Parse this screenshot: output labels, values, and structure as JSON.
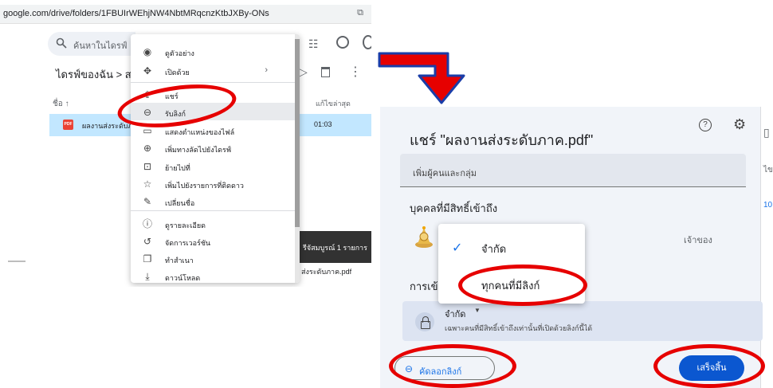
{
  "drive": {
    "url": "google.com/drive/folders/1FBUIrWEhjNW4NbtMRqcnzKtbJXBy-ONs",
    "search_placeholder": "ค้นหาในไดรฟ์",
    "breadcrumb": "ไดรฟ์ของฉัน  >  ส",
    "column_name": "ชื่อ ↑",
    "column_modified": "แก้ไขล่าสุด",
    "file": {
      "name": "ผลงานส่งระดับภ",
      "time": "01:03",
      "icon_label": "PDF"
    },
    "notification": "รีจัสมบูรณ์ 1 รายการ",
    "notification_sub": "ส่งระดับภาค.pdf"
  },
  "context_menu": {
    "items": [
      {
        "icon": "eye-icon",
        "glyph": "◉",
        "label": "ดูตัวอย่าง",
        "chevron": ""
      },
      {
        "icon": "open-with-icon",
        "glyph": "✥",
        "label": "เปิดด้วย",
        "chevron": "›"
      },
      {
        "icon": "share-icon",
        "glyph": "⇪",
        "label": "แชร์",
        "chevron": ""
      },
      {
        "icon": "link-icon",
        "glyph": "⊖",
        "label": "รับลิงก์",
        "chevron": ""
      },
      {
        "icon": "file-location-icon",
        "glyph": "▭",
        "label": "แสดงตำแหน่งของไฟล์",
        "chevron": ""
      },
      {
        "icon": "shortcut-icon",
        "glyph": "⊕",
        "label": "เพิ่มทางลัดไปยังไดรฟ์",
        "chevron": ""
      },
      {
        "icon": "move-icon",
        "glyph": "⊡",
        "label": "ย้ายไปที่",
        "chevron": ""
      },
      {
        "icon": "star-icon",
        "glyph": "☆",
        "label": "เพิ่มไปยังรายการที่ติดดาว",
        "chevron": ""
      },
      {
        "icon": "rename-icon",
        "glyph": "✎",
        "label": "เปลี่ยนชื่อ",
        "chevron": ""
      },
      {
        "icon": "info-icon",
        "glyph": "ⓘ",
        "label": "ดูรายละเอียด",
        "chevron": ""
      },
      {
        "icon": "history-icon",
        "glyph": "↺",
        "label": "จัดการเวอร์ชัน",
        "chevron": ""
      },
      {
        "icon": "copy-icon",
        "glyph": "❐",
        "label": "ทำสำเนา",
        "chevron": ""
      },
      {
        "icon": "download-icon",
        "glyph": "⤓",
        "label": "ดาวน์โหลด",
        "chevron": ""
      }
    ]
  },
  "share_dialog": {
    "title": "แชร์ \"ผลงานส่งระดับภาค.pdf\"",
    "add_people_placeholder": "เพิ่มผู้คนและกลุ่ม",
    "people_header": "บุคคลที่มีสิทธิ์เข้าถึง",
    "owner_label": "เจ้าของ",
    "general_access_header": "การเข้",
    "dropdown": {
      "check": "✓",
      "option_restricted": "จำกัด",
      "option_anyone": "ทุกคนที่มีลิงก์"
    },
    "access_level": "จำกัด",
    "access_caret": "▼",
    "access_description": "เฉพาะคนที่มีสิทธิ์เข้าถึงเท่านั้นที่เปิดด้วยลิงก์นี้ได้",
    "copy_link_button": "คัดลอกลิงก์",
    "done_button": "เสร็จสิ้น",
    "help_glyph": "?",
    "gear_glyph": "⚙"
  },
  "annotation_color": "#e60000",
  "accent_color": "#0b57d0"
}
